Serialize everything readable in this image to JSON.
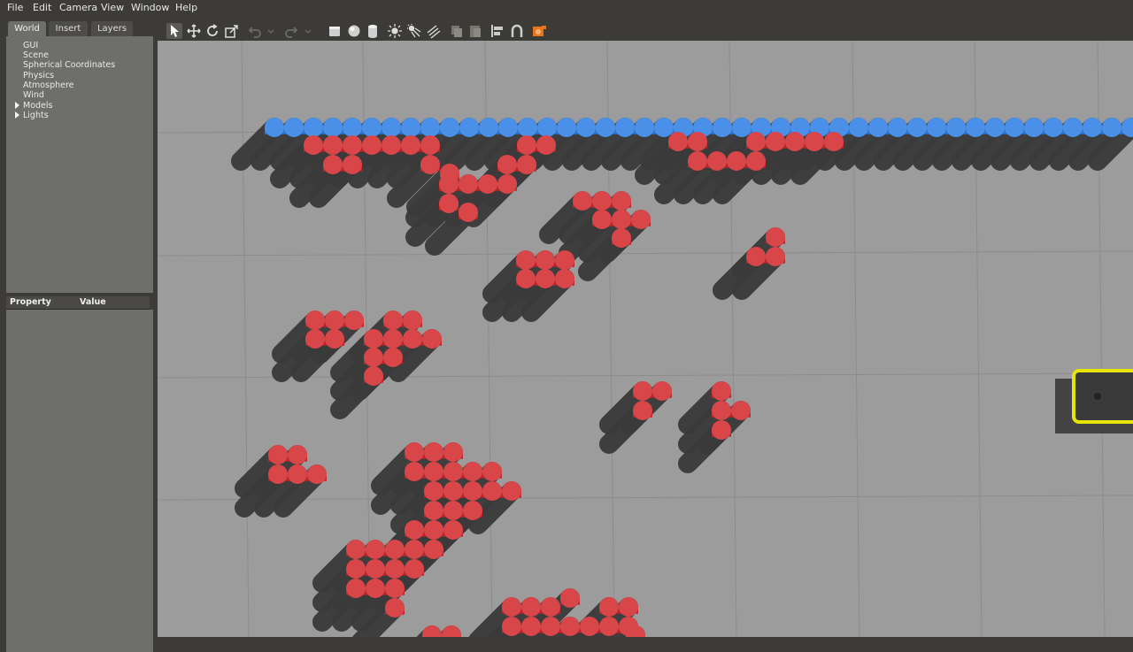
{
  "menu": [
    "File",
    "Edit",
    "Camera",
    "View",
    "Window",
    "Help"
  ],
  "tabs": [
    "World",
    "Insert",
    "Layers"
  ],
  "world_tree": [
    {
      "label": "GUI",
      "expandable": false
    },
    {
      "label": "Scene",
      "expandable": false
    },
    {
      "label": "Spherical Coordinates",
      "expandable": false
    },
    {
      "label": "Physics",
      "expandable": false
    },
    {
      "label": "Atmosphere",
      "expandable": false
    },
    {
      "label": "Wind",
      "expandable": false
    },
    {
      "label": "Models",
      "expandable": true
    },
    {
      "label": "Lights",
      "expandable": true
    }
  ],
  "property_panel": {
    "property_header": "Property",
    "value_header": "Value"
  },
  "toolbar_icons": [
    "select-mode-icon",
    "translate-mode-icon",
    "rotate-mode-icon",
    "scale-mode-icon",
    "undo-icon",
    "undo-dropdown-icon",
    "redo-icon",
    "redo-dropdown-icon",
    "box-shape-icon",
    "sphere-shape-icon",
    "cylinder-shape-icon",
    "point-light-icon",
    "spot-light-icon",
    "directional-light-icon",
    "copy-icon",
    "paste-icon",
    "align-icon",
    "snap-icon",
    "screenshot-icon"
  ],
  "colors": {
    "ground": "#9c9c9c",
    "grid": "#8c8c8c",
    "red_cylinder": "#b8262c",
    "red_cylinder_top": "#d8464a",
    "blue_cylinder": "#2f74d6",
    "blue_cylinder_top": "#4a90e8",
    "shadow": "#3a3a3a",
    "robot_body": "#3a3a3a",
    "robot_outline": "#e6e600"
  }
}
